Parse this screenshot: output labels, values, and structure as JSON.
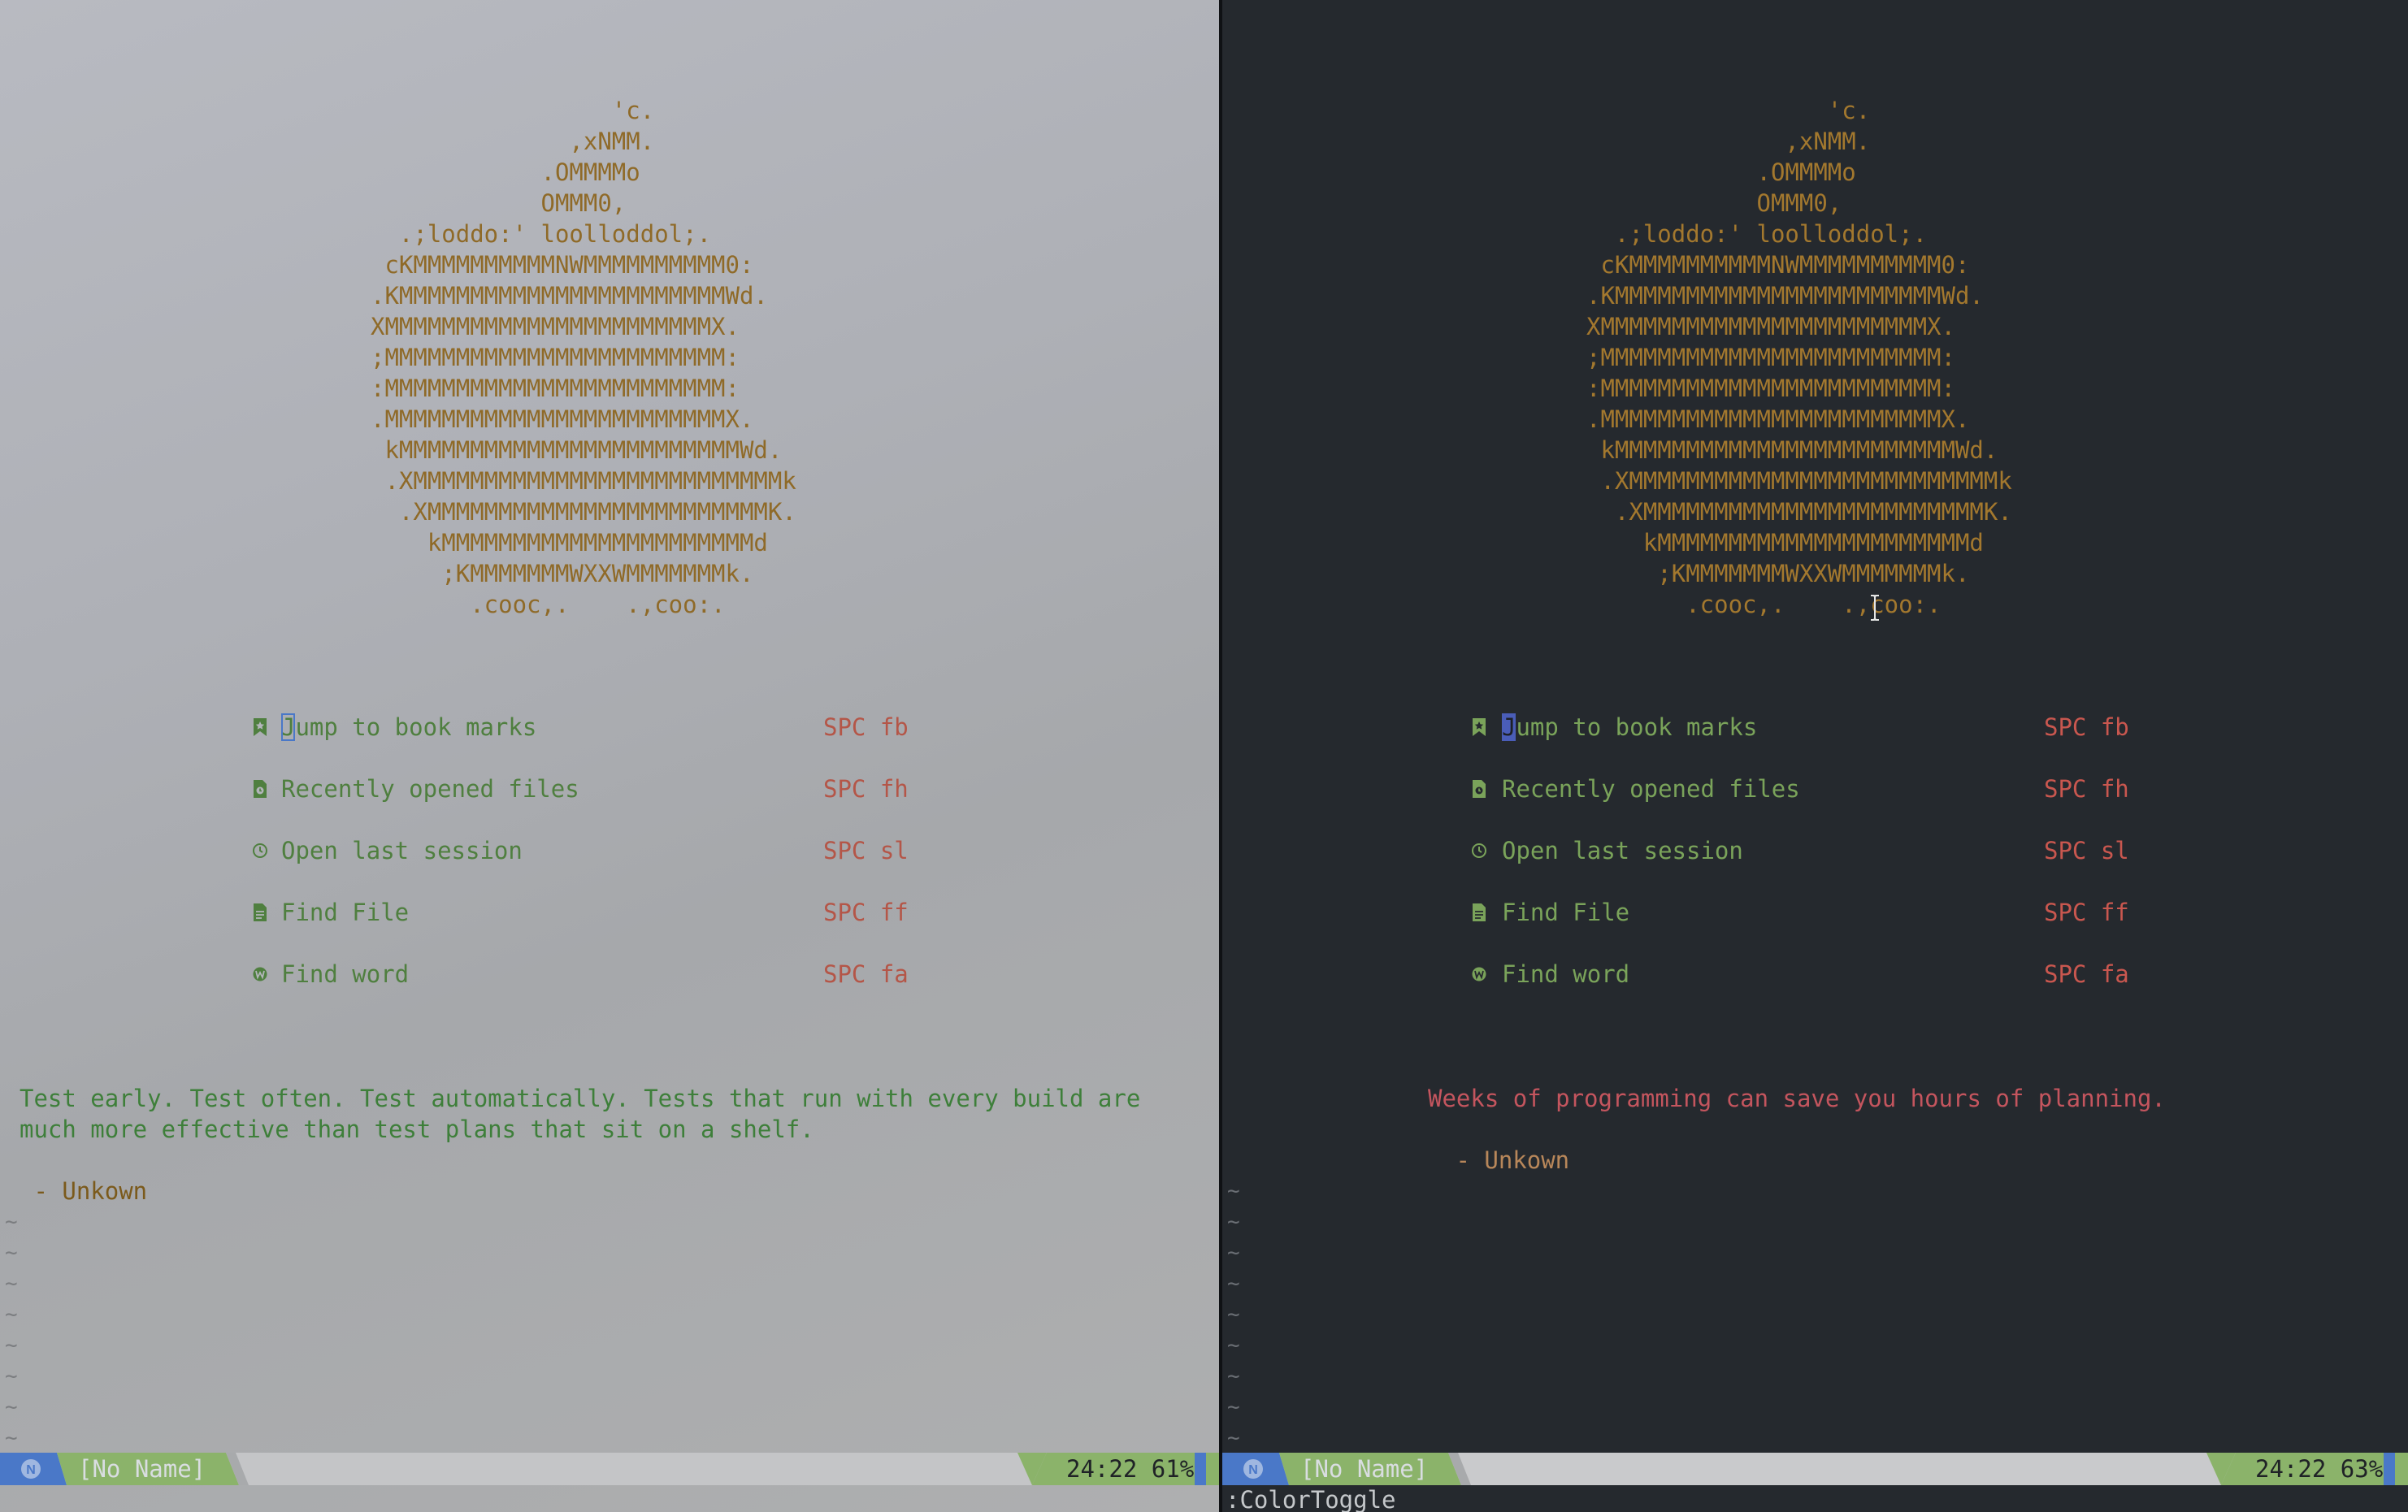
{
  "logo_lines": [
    "                 'c.",
    "              ,xNMM.",
    "            .OMMMMo",
    "            OMMM0,",
    "  .;loddo:' loolloddol;.",
    " cKMMMMMMMMMMNWMMMMMMMMMM0:",
    ".KMMMMMMMMMMMMMMMMMMMMMMMWd.",
    "XMMMMMMMMMMMMMMMMMMMMMMMX.",
    ";MMMMMMMMMMMMMMMMMMMMMMMM:",
    ":MMMMMMMMMMMMMMMMMMMMMMMM:",
    ".MMMMMMMMMMMMMMMMMMMMMMMMX.",
    " kMMMMMMMMMMMMMMMMMMMMMMMMWd.",
    " .XMMMMMMMMMMMMMMMMMMMMMMMMMMk",
    "  .XMMMMMMMMMMMMMMMMMMMMMMMMK.",
    "    kMMMMMMMMMMMMMMMMMMMMMMd",
    "     ;KMMMMMMMWXXWMMMMMMMk.",
    "       .cooc,.    .,coo:."
  ],
  "menu_items": [
    {
      "icon": "bookmark-icon",
      "first": "J",
      "rest": "ump to book marks",
      "key": "SPC fb"
    },
    {
      "icon": "recent-files-icon",
      "first": "R",
      "rest": "ecently opened files",
      "key": "SPC fh"
    },
    {
      "icon": "session-icon",
      "first": "O",
      "rest": "pen last session",
      "key": "SPC sl"
    },
    {
      "icon": "file-icon",
      "first": "F",
      "rest": "ind File",
      "key": "SPC ff"
    },
    {
      "icon": "word-icon",
      "first": "F",
      "rest": "ind word",
      "key": "SPC fa"
    }
  ],
  "left": {
    "quote_line1": "Test early. Test often. Test automatically. Tests that run with every build are",
    "quote_line2": "much more effective than test plans that sit on a shelf.",
    "author": " - Unkown",
    "status": {
      "mode": "N",
      "filename": "[No Name]",
      "position": "24:22",
      "percent": "61%"
    }
  },
  "right": {
    "quote": "Weeks of programming can save you hours of planning.",
    "author": " - Unkown",
    "status": {
      "mode": "N",
      "filename": "[No Name]",
      "position": "24:22",
      "percent": "63%"
    },
    "command": ":ColorToggle"
  },
  "colors": {
    "accent_blue": "#4a78c8",
    "status_green": "#8bb36a",
    "status_gray": "#c9cacc",
    "key_red": "#c9574f",
    "label_green": "#7aa35a",
    "logo_gold": "#a3782e"
  }
}
